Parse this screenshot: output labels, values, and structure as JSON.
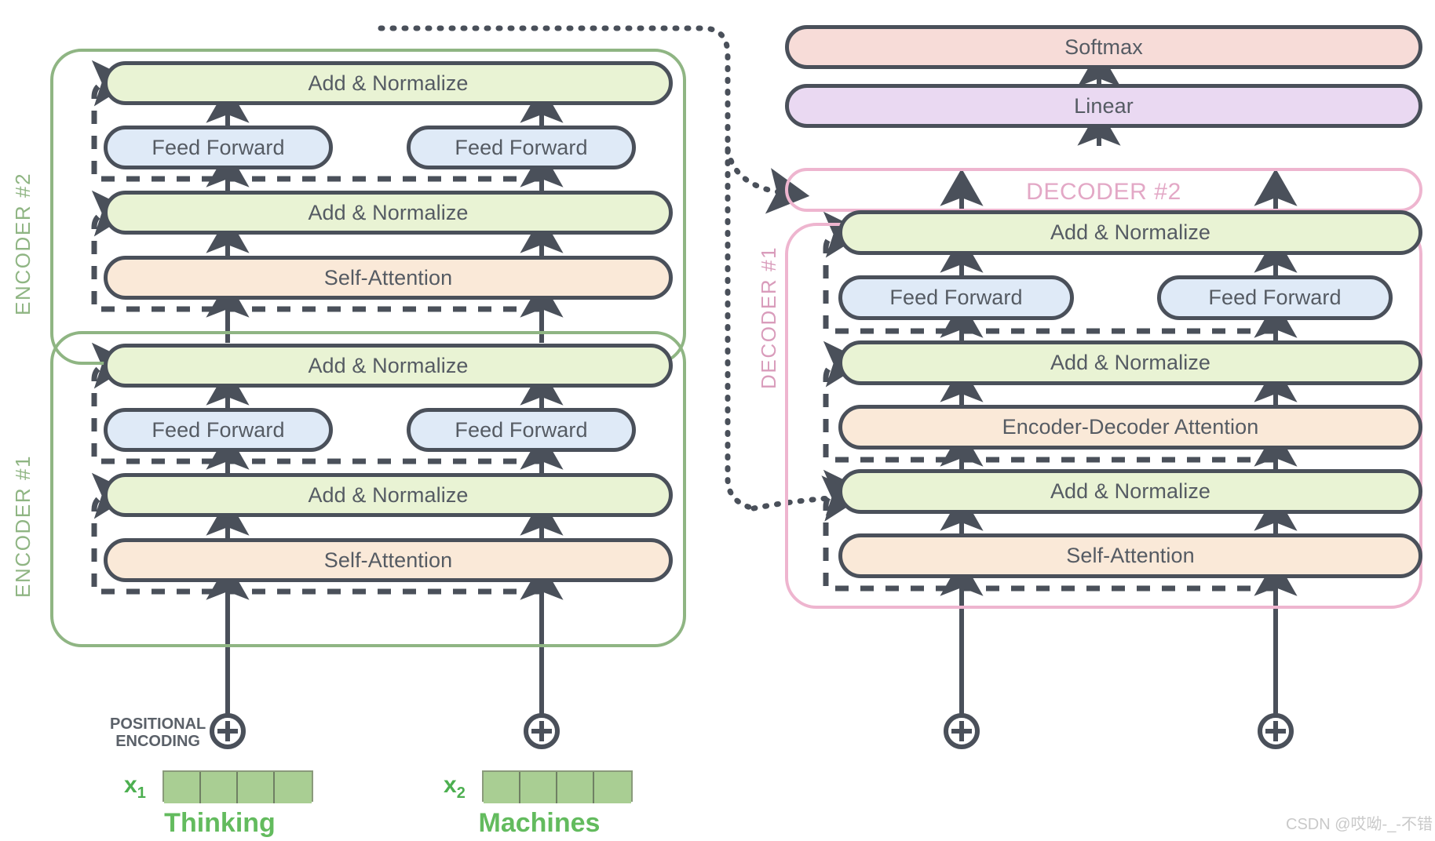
{
  "title": "Transformer Encoder-Decoder Architecture",
  "colors": {
    "add_norm": "#e9f3d4",
    "feed_forward": "#dfeaf7",
    "attention": "#fae9d8",
    "softmax": "#f7dcd8",
    "linear": "#ead9f2",
    "encoder_border": "#8fb583",
    "decoder_border": "#eeb5cf",
    "box_border": "#4a505a",
    "word_text": "#63bb5e",
    "embed_cell": "#a9ce93"
  },
  "encoder": {
    "stack_label_2": "ENCODER #2",
    "stack_label_1": "ENCODER #1",
    "block2": {
      "add_norm_top": "Add & Normalize",
      "feed_forward_left": "Feed Forward",
      "feed_forward_right": "Feed Forward",
      "add_norm_bottom": "Add & Normalize",
      "self_attention": "Self-Attention"
    },
    "block1": {
      "add_norm_top": "Add & Normalize",
      "feed_forward_left": "Feed Forward",
      "feed_forward_right": "Feed Forward",
      "add_norm_bottom": "Add & Normalize",
      "self_attention": "Self-Attention"
    }
  },
  "decoder": {
    "softmax": "Softmax",
    "linear": "Linear",
    "decoder2_label": "DECODER #2",
    "decoder1_label": "DECODER #1",
    "block1": {
      "add_norm_top": "Add & Normalize",
      "feed_forward_left": "Feed Forward",
      "feed_forward_right": "Feed Forward",
      "add_norm_middle": "Add & Normalize",
      "encoder_decoder_attention": "Encoder-Decoder Attention",
      "add_norm_bottom": "Add & Normalize",
      "self_attention": "Self-Attention"
    }
  },
  "inputs": {
    "positional_encoding_line1": "POSITIONAL",
    "positional_encoding_line2": "ENCODING",
    "tokens": [
      {
        "vector_label": "x",
        "vector_index": "1",
        "word": "Thinking",
        "cells": 4
      },
      {
        "vector_label": "x",
        "vector_index": "2",
        "word": "Machines",
        "cells": 4
      }
    ]
  },
  "watermark": "CSDN @哎呦-_-不错"
}
